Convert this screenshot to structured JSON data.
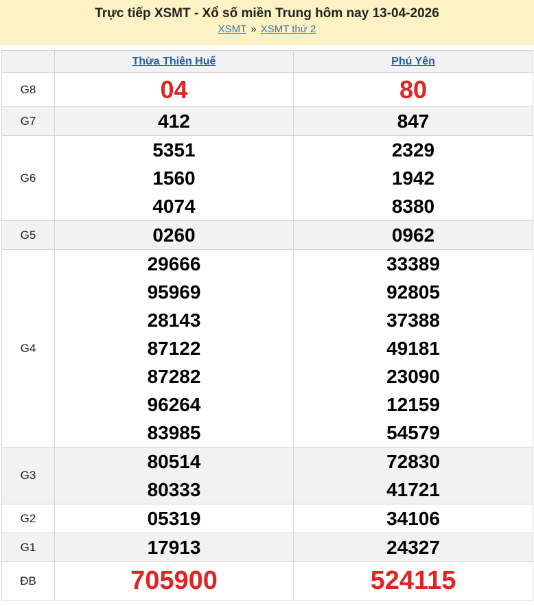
{
  "header": {
    "title": "Trực tiếp XSMT - Xổ số miền Trung hôm nay 13-04-2026",
    "crumb_1": "XSMT",
    "crumb_sep": "»",
    "crumb_2": "XSMT thứ 2"
  },
  "table": {
    "provinces": [
      "Thừa Thiên Huế",
      "Phú Yên"
    ],
    "prizes": {
      "G8": {
        "label": "G8",
        "p1": [
          "04"
        ],
        "p2": [
          "80"
        ]
      },
      "G7": {
        "label": "G7",
        "p1": [
          "412"
        ],
        "p2": [
          "847"
        ]
      },
      "G6": {
        "label": "G6",
        "p1": [
          "5351",
          "1560",
          "4074"
        ],
        "p2": [
          "2329",
          "1942",
          "8380"
        ]
      },
      "G5": {
        "label": "G5",
        "p1": [
          "0260"
        ],
        "p2": [
          "0962"
        ]
      },
      "G4": {
        "label": "G4",
        "p1": [
          "29666",
          "95969",
          "28143",
          "87122",
          "87282",
          "96264",
          "83985"
        ],
        "p2": [
          "33389",
          "92805",
          "37388",
          "49181",
          "23090",
          "12159",
          "54579"
        ]
      },
      "G3": {
        "label": "G3",
        "p1": [
          "80514",
          "80333"
        ],
        "p2": [
          "72830",
          "41721"
        ]
      },
      "G2": {
        "label": "G2",
        "p1": [
          "05319"
        ],
        "p2": [
          "34106"
        ]
      },
      "G1": {
        "label": "G1",
        "p1": [
          "17913"
        ],
        "p2": [
          "24327"
        ]
      },
      "DB": {
        "label": "ĐB",
        "p1": [
          "705900"
        ],
        "p2": [
          "524115"
        ]
      }
    }
  },
  "colors": {
    "header_bg": "#fdf2c3",
    "link": "#2a5c9a",
    "highlight_red": "#e02424",
    "row_shade": "#f2f2f2"
  }
}
